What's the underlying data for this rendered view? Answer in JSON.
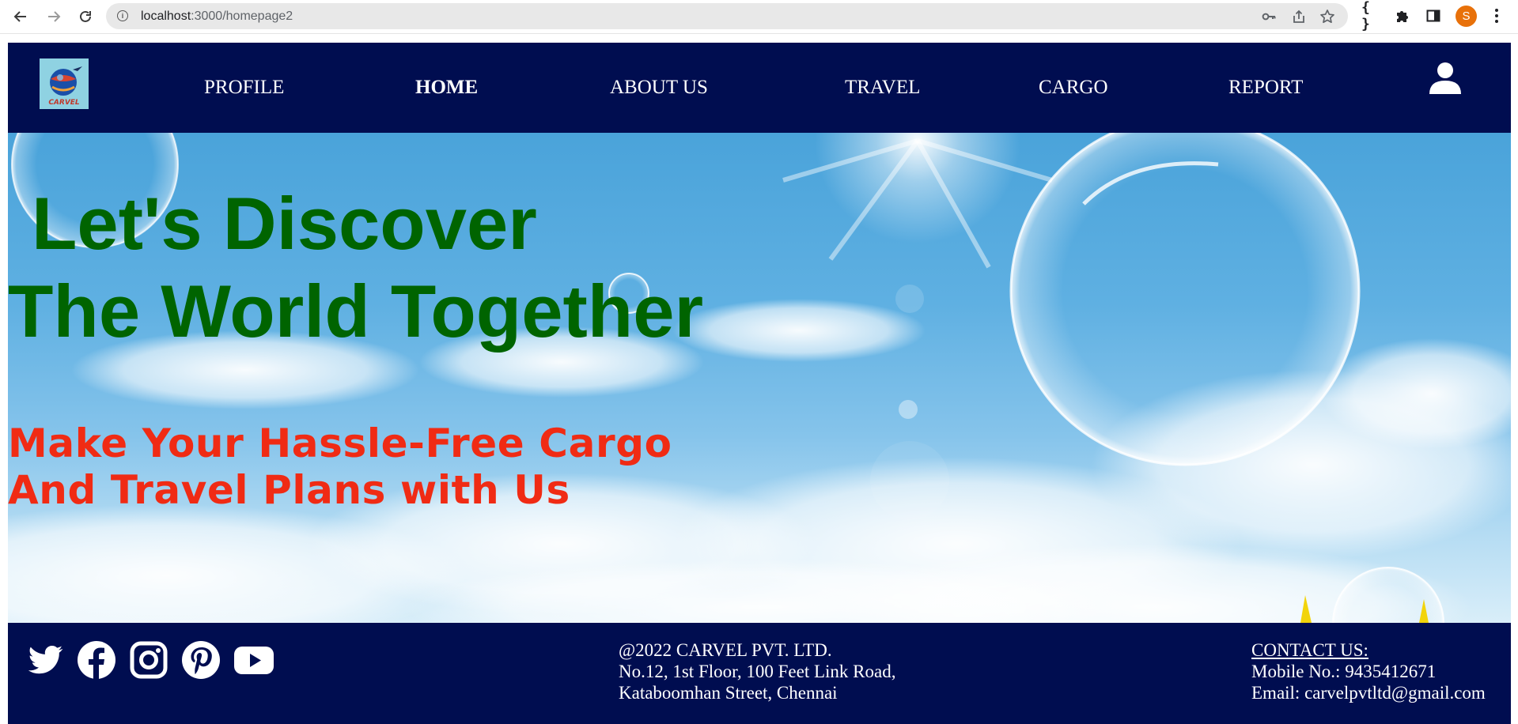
{
  "browser": {
    "url_host": "localhost",
    "url_path": ":3000/homepage2",
    "profile_initial": "S"
  },
  "header": {
    "logo_text": "CARVEL",
    "nav": [
      {
        "label": "PROFILE",
        "active": false
      },
      {
        "label": "HOME",
        "active": true
      },
      {
        "label": "ABOUT US",
        "active": false
      },
      {
        "label": "TRAVEL",
        "active": false
      },
      {
        "label": "CARGO",
        "active": false
      },
      {
        "label": "REPORT",
        "active": false
      }
    ]
  },
  "hero": {
    "headline_line1": "Let's Discover",
    "headline_line2": "The World Together",
    "tagline_line1": "Make Your Hassle-Free Cargo",
    "tagline_line2": "And Travel Plans with Us"
  },
  "footer": {
    "social_icons": [
      "twitter-icon",
      "facebook-icon",
      "instagram-icon",
      "pinterest-icon",
      "youtube-icon"
    ],
    "copyright": "@2022 CARVEL PVT. LTD.",
    "address_line1": "No.12, 1st Floor, 100 Feet Link Road,",
    "address_line2": "Kataboomhan Street, Chennai",
    "contact_heading": "CONTACT US:",
    "mobile": "Mobile No.: 9435412671",
    "email": "Email: carvelpvtltd@gmail.com"
  },
  "colors": {
    "navy": "#000d50",
    "headline_green": "#006400",
    "tagline_red": "#f02b14",
    "avatar_orange": "#e8710a"
  }
}
